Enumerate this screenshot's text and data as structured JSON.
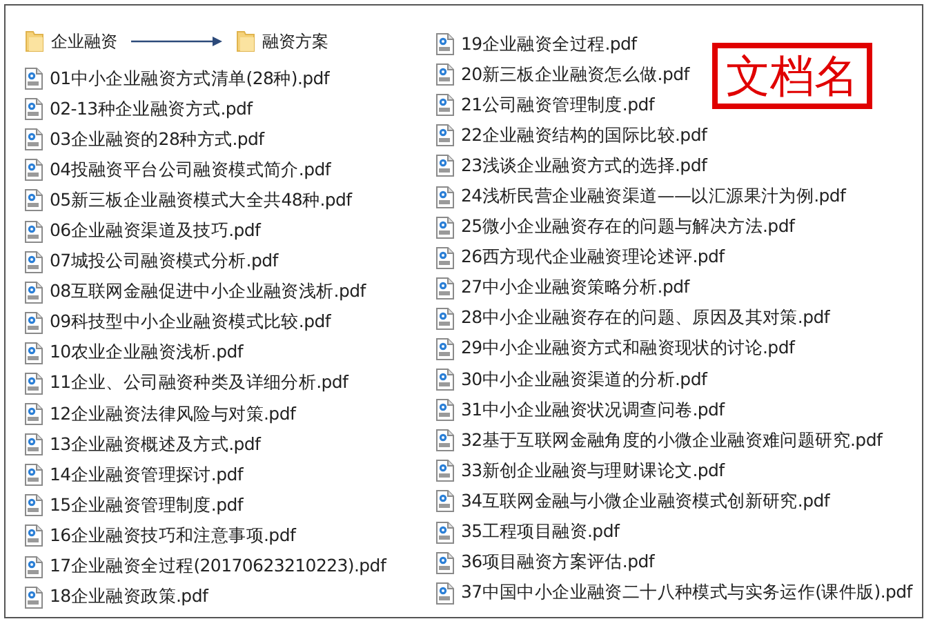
{
  "breadcrumb": {
    "source_folder": "企业融资",
    "target_folder": "融资方案"
  },
  "annotation": "文档名",
  "file_columns": [
    [
      "01中小企业融资方式清单(28种).pdf",
      "02-13种企业融资方式.pdf",
      "03企业融资的28种方式.pdf",
      "04投融资平台公司融资模式简介.pdf",
      "05新三板企业融资模式大全共48种.pdf",
      "06企业融资渠道及技巧.pdf",
      "07城投公司融资模式分析.pdf",
      "08互联网金融促进中小企业融资浅析.pdf",
      "09科技型中小企业融资模式比较.pdf",
      "10农业企业融资浅析.pdf",
      "11企业、公司融资种类及详细分析.pdf",
      "12企业融资法律风险与对策.pdf",
      "13企业融资概述及方式.pdf",
      "14企业融资管理探讨.pdf",
      "15企业融资管理制度.pdf",
      "16企业融资技巧和注意事项.pdf",
      "17企业融资全过程(20170623210223).pdf",
      "18企业融资政策.pdf"
    ],
    [
      "19企业融资全过程.pdf",
      "20新三板企业融资怎么做.pdf",
      "21公司融资管理制度.pdf",
      "22企业融资结构的国际比较.pdf",
      "23浅谈企业融资方式的选择.pdf",
      "24浅析民营企业融资渠道——以汇源果汁为例.pdf",
      "25微小企业融资存在的问题与解决方法.pdf",
      "26西方现代企业融资理论述评.pdf",
      "27中小企业融资策略分析.pdf",
      "28中小企业融资存在的问题、原因及其对策.pdf",
      "29中小企业融资方式和融资现状的讨论.pdf",
      "30中小企业融资渠道的分析.pdf",
      "31中小企业融资状况调查问卷.pdf",
      "32基于互联网金融角度的小微企业融资难问题研究.pdf",
      "33新创企业融资与理财课论文.pdf",
      "34互联网金融与小微企业融资模式创新研究.pdf",
      "35工程项目融资.pdf",
      "36项目融资方案评估.pdf",
      "37中国中小企业融资二十八种模式与实务运作(课件版).pdf"
    ]
  ]
}
